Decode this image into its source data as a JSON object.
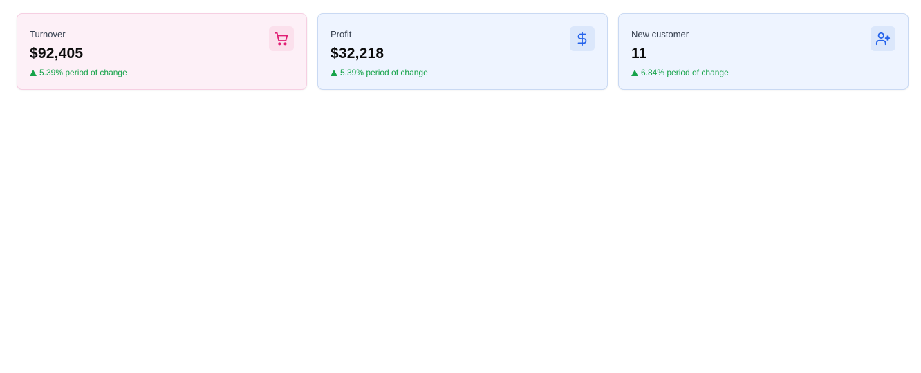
{
  "cards": [
    {
      "title": "Turnover",
      "value": "$92,405",
      "change_text": "5.39% period of change",
      "icon": "shopping-cart-icon",
      "accent": "#e11d74"
    },
    {
      "title": "Profit",
      "value": "$32,218",
      "change_text": "5.39% period of change",
      "icon": "dollar-icon",
      "accent": "#2563eb"
    },
    {
      "title": "New customer",
      "value": "11",
      "change_text": "6.84% period of change",
      "icon": "user-plus-icon",
      "accent": "#2563eb"
    }
  ],
  "colors": {
    "positive_change": "#16a34a",
    "pink_card_bg": "#fdf0f7",
    "blue_card_bg": "#eef4ff"
  }
}
